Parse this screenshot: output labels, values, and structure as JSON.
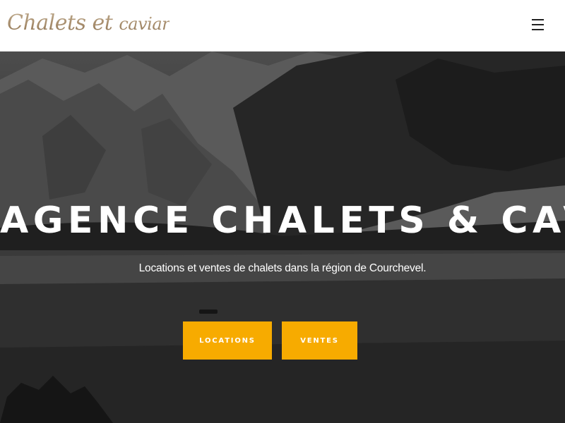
{
  "header": {
    "logo_main": "Chalets et",
    "logo_small": "caviar",
    "menu_icon": "hamburger-menu-icon"
  },
  "hero": {
    "title": "AGENCE CHALETS & CAVIAR",
    "subtitle": "Locations et ventes de chalets dans la région de Courchevel.",
    "buttons": {
      "locations": "LOCATIONS",
      "ventes": "VENTES"
    }
  },
  "colors": {
    "accent": "#f7ab00",
    "header_bg": "#ffffff",
    "logo_gold": "#a58b6a",
    "text": "#ffffff"
  }
}
